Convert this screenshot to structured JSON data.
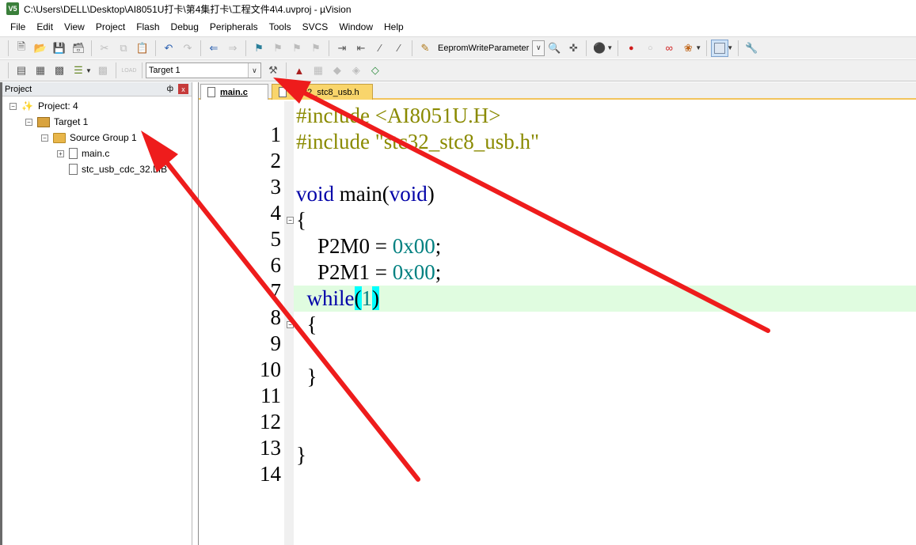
{
  "window": {
    "title": "C:\\Users\\DELL\\Desktop\\AI8051U打卡\\第4集打卡\\工程文件4\\4.uvproj - µVision",
    "app_icon_label": "V5"
  },
  "menu": {
    "items": [
      "File",
      "Edit",
      "View",
      "Project",
      "Flash",
      "Debug",
      "Peripherals",
      "Tools",
      "SVCS",
      "Window",
      "Help"
    ]
  },
  "toolbar1": {
    "eeprom_label": "EepromWriteParameter"
  },
  "toolbar2": {
    "target_value": "Target 1"
  },
  "project_panel": {
    "title": "Project",
    "pin": "ф",
    "close": "x",
    "tree": {
      "project": "Project: 4",
      "target": "Target 1",
      "group": "Source Group 1",
      "files": [
        "main.c",
        "stc_usb_cdc_32.LIB"
      ]
    }
  },
  "editor": {
    "tabs": [
      {
        "label": "main.c",
        "active": true
      },
      {
        "label": "stc32_stc8_usb.h",
        "active": false
      }
    ],
    "line_numbers": [
      "1",
      "2",
      "3",
      "4",
      "5",
      "6",
      "7",
      "8",
      "9",
      "10",
      "11",
      "12",
      "13",
      "14"
    ],
    "code": {
      "l1_directive": "#include",
      "l1_rest": " <AI8051U.H>",
      "l2_directive": "#include",
      "l2_rest": " \"stc32_stc8_usb.h\"",
      "l4_void1": "void",
      "l4_main": " main(",
      "l4_void2": "void",
      "l4_close": ")",
      "l5": "{",
      "l6_reg": "    P2M0 = ",
      "l6_val": "0x00",
      "l6_end": ";",
      "l7_reg": "    P2M1 = ",
      "l7_val": "0x00",
      "l7_end": ";",
      "l8_while": "  while",
      "l8_open": "(",
      "l8_val": "1",
      "l8_close": ")",
      "l9": "  {",
      "l11": "  }",
      "l14": "}"
    },
    "current_line": 8
  },
  "colors": {
    "keyword": "#0000a8",
    "preprocessor": "#8a8a00",
    "number": "#008080",
    "current_line_bg": "#e0fce0",
    "bracket_highlight": "#00ffff",
    "annotation_arrow": "#ee1c1c"
  }
}
